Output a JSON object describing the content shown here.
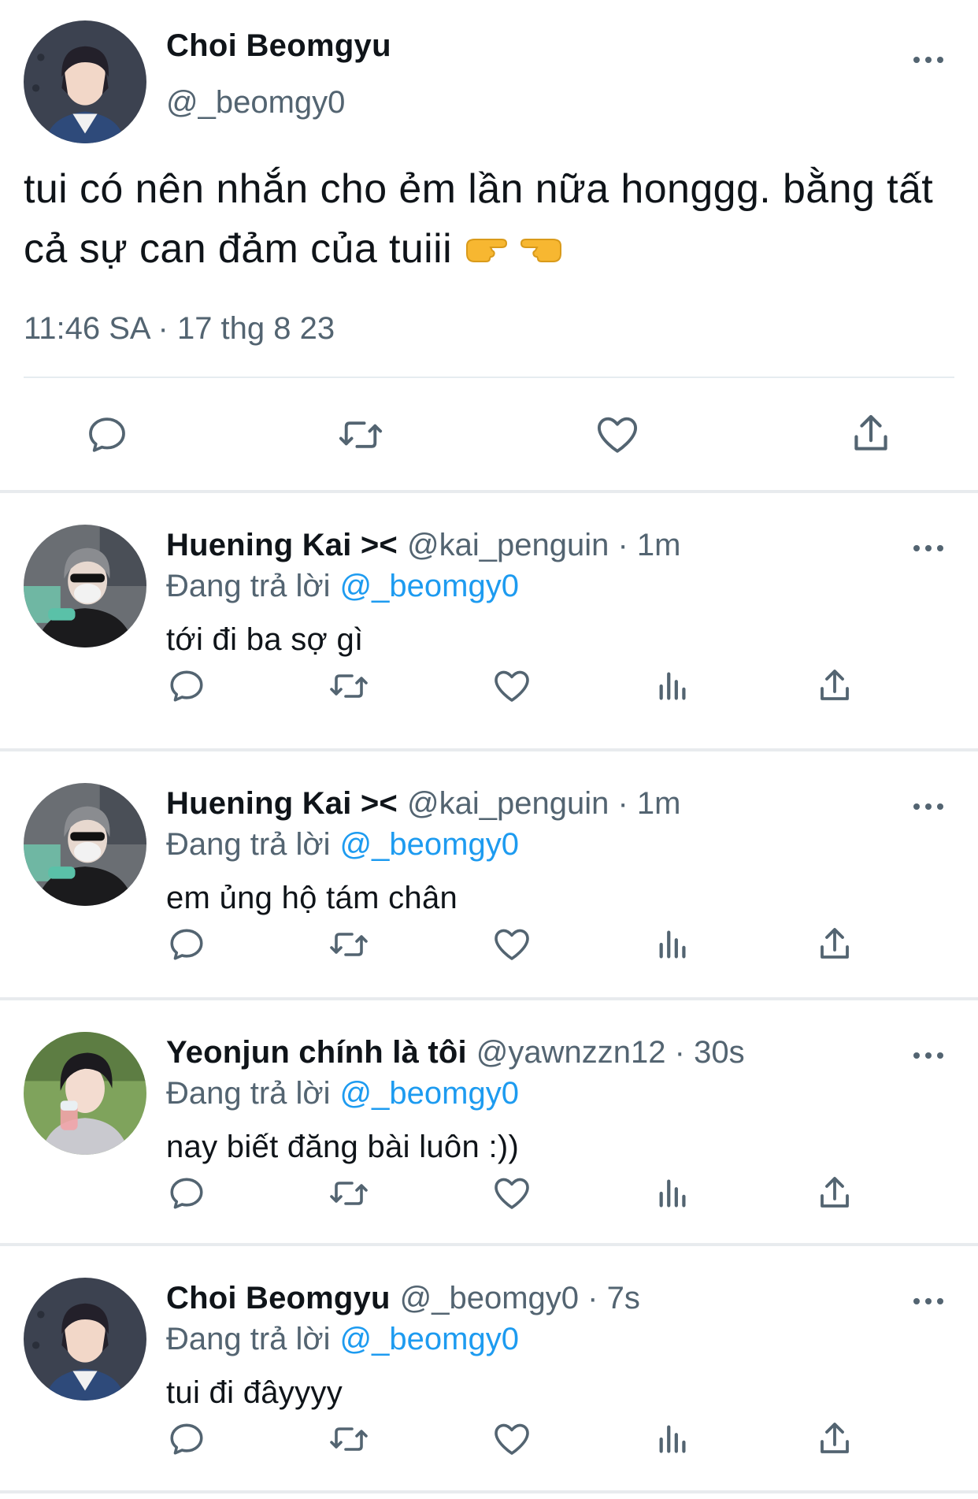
{
  "main_tweet": {
    "name": "Choi Beomgyu",
    "handle": "@_beomgy0",
    "text": "tui có nên nhắn cho ẻm lần nữa honggg. bằng tất cả sự can đảm của tuiii",
    "emojis": [
      "backhand-index-pointing-right",
      "backhand-index-pointing-left"
    ],
    "timestamp": "11:46 SA · 17 thg 8 23",
    "actions": [
      "reply-icon",
      "retweet-icon",
      "like-icon",
      "share-icon"
    ]
  },
  "replies": [
    {
      "name": "Huening Kai ><",
      "handle": "@kai_penguin",
      "time": "· 1m",
      "replying_prefix": "Đang trả lời",
      "replying_to": "@_beomgy0",
      "text": "tới đi ba sợ gì"
    },
    {
      "name": "Huening Kai ><",
      "handle": "@kai_penguin",
      "time": "· 1m",
      "replying_prefix": "Đang trả lời",
      "replying_to": "@_beomgy0",
      "text": "em ủng hộ tám chân"
    },
    {
      "name": "Yeonjun chính là tôi",
      "handle": "@yawnzzn12",
      "time": "· 30s",
      "replying_prefix": "Đang trả lời",
      "replying_to": "@_beomgy0",
      "text": "nay biết đăng bài luôn :))"
    },
    {
      "name": "Choi Beomgyu",
      "handle": "@_beomgy0",
      "time": "· 7s",
      "replying_prefix": "Đang trả lời",
      "replying_to": "@_beomgy0",
      "text": "tui đi đâyyyy"
    }
  ],
  "colors": {
    "text": "#0f1419",
    "secondary": "#536471",
    "accent": "#1d9bf0",
    "divider": "#e8ebee"
  }
}
